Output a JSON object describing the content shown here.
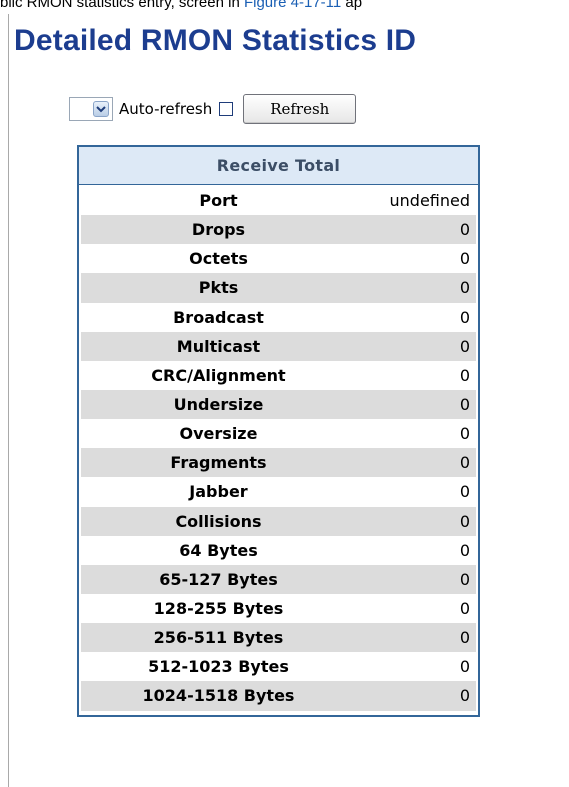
{
  "caption": {
    "before": "blic RMON statistics entry, screen in ",
    "link": "Figure 4-17-11",
    "after": " ap"
  },
  "page_title": "Detailed RMON Statistics  ID",
  "controls": {
    "select_value": "",
    "auto_refresh_label": "Auto-refresh",
    "auto_refresh_checked": false,
    "refresh_label": "Refresh"
  },
  "table": {
    "header": "Receive Total",
    "rows": [
      {
        "label": "Port",
        "value": "undefined"
      },
      {
        "label": "Drops",
        "value": "0"
      },
      {
        "label": "Octets",
        "value": "0"
      },
      {
        "label": "Pkts",
        "value": "0"
      },
      {
        "label": "Broadcast",
        "value": "0"
      },
      {
        "label": "Multicast",
        "value": "0"
      },
      {
        "label": "CRC/Alignment",
        "value": "0"
      },
      {
        "label": "Undersize",
        "value": "0"
      },
      {
        "label": "Oversize",
        "value": "0"
      },
      {
        "label": "Fragments",
        "value": "0"
      },
      {
        "label": "Jabber",
        "value": "0"
      },
      {
        "label": "Collisions",
        "value": "0"
      },
      {
        "label": "64 Bytes",
        "value": "0"
      },
      {
        "label": "65-127 Bytes",
        "value": "0"
      },
      {
        "label": "128-255 Bytes",
        "value": "0"
      },
      {
        "label": "256-511 Bytes",
        "value": "0"
      },
      {
        "label": "512-1023 Bytes",
        "value": "0"
      },
      {
        "label": "1024-1518 Bytes",
        "value": "0"
      }
    ]
  },
  "colors": {
    "title": "#1c3d8f",
    "table_border": "#336699",
    "header_bg": "#dde9f6",
    "alt_row_bg": "#dcdcdc",
    "link": "#1a5fb4"
  },
  "icons": {
    "select_arrow": "chevron-down-icon"
  }
}
